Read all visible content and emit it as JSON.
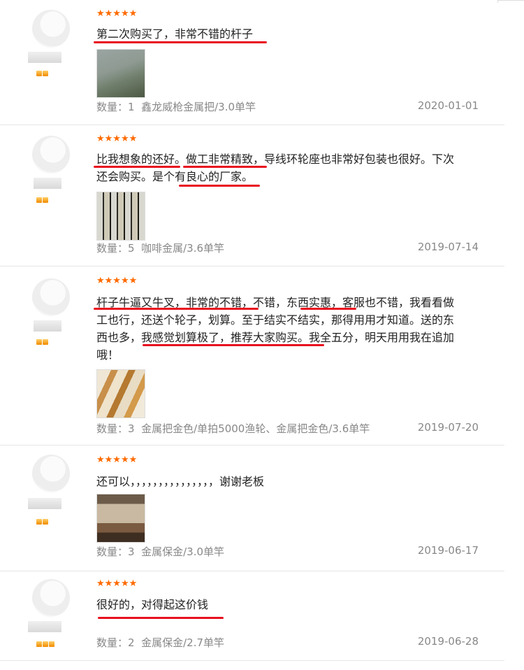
{
  "reviews": [
    {
      "stars": "★★★★★",
      "lines": [
        "第二次购买了，非常不错的杆子"
      ],
      "qty_label": "数量：",
      "qty": "1",
      "spec": "鑫龙威枪金属把/3.0单竿",
      "date": "2020-01-01"
    },
    {
      "stars": "★★★★★",
      "lines": [
        "比我想象的还好。做工非常精致，导线环轮座也非常好包装也很好。下次",
        "还会购买。是个有良心的厂家。"
      ],
      "qty_label": "数量：",
      "qty": "5",
      "spec": "咖啡金属/3.6单竿",
      "date": "2019-07-14"
    },
    {
      "stars": "★★★★★",
      "lines": [
        "杆子牛逼又牛叉，非常的不错，不错，东西实惠，客服也不错，我看看做",
        "工也行，还送个轮子，划算。至于结实不结实，那得用用才知道。送的东",
        "西也多，我感觉划算极了，推荐大家购买。我全五分，明天用用我在追加",
        "哦！"
      ],
      "qty_label": "数量：",
      "qty": "3",
      "spec": "金属把金色/单拍5000渔轮、金属把金色/3.6单竿",
      "date": "2019-07-20"
    },
    {
      "stars": "★★★★★",
      "lines": [
        "还可以，，，，，，，，，，，，，，，谢谢老板"
      ],
      "qty_label": "数量：",
      "qty": "3",
      "spec": "金属保金/3.0单竿",
      "date": "2019-06-17"
    },
    {
      "stars": "★★★★★",
      "lines": [
        "很好的，对得起这价钱"
      ],
      "qty_label": "数量：",
      "qty": "2",
      "spec": "金属保金/2.7单竿",
      "date": "2019-06-28"
    }
  ]
}
